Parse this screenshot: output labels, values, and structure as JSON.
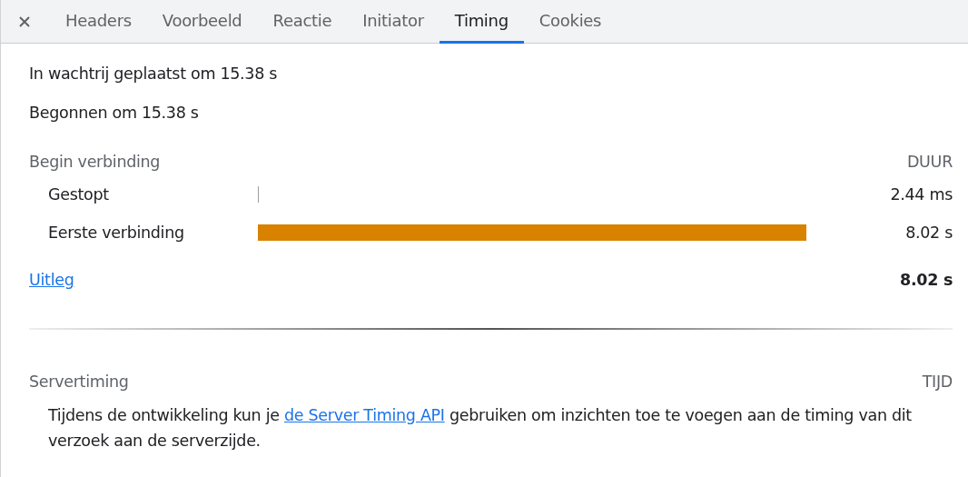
{
  "tabs": [
    {
      "label": "Headers",
      "selected": false
    },
    {
      "label": "Voorbeeld",
      "selected": false
    },
    {
      "label": "Reactie",
      "selected": false
    },
    {
      "label": "Initiator",
      "selected": false
    },
    {
      "label": "Timing",
      "selected": true
    },
    {
      "label": "Cookies",
      "selected": false
    }
  ],
  "info": [
    "In wachtrij geplaatst om 15.38 s",
    "Begonnen om 15.38 s"
  ],
  "connection": {
    "title": "Begin verbinding",
    "column": "DUUR",
    "rows": [
      {
        "label": "Gestopt",
        "kind": "tick",
        "color": "#9e9e9e",
        "value": "2.44 ms"
      },
      {
        "label": "Eerste verbinding",
        "kind": "span",
        "color": "#d98200",
        "value": "8.02 s"
      }
    ]
  },
  "explanation_link": "Uitleg",
  "total": "8.02 s",
  "server_timing": {
    "title": "Servertiming",
    "column": "TIJD",
    "text_before": "Tijdens de ontwikkeling kun je ",
    "link": "de Server Timing API",
    "text_after": " gebruiken om inzichten toe te voegen aan de timing van dit verzoek aan de serverzijde."
  }
}
